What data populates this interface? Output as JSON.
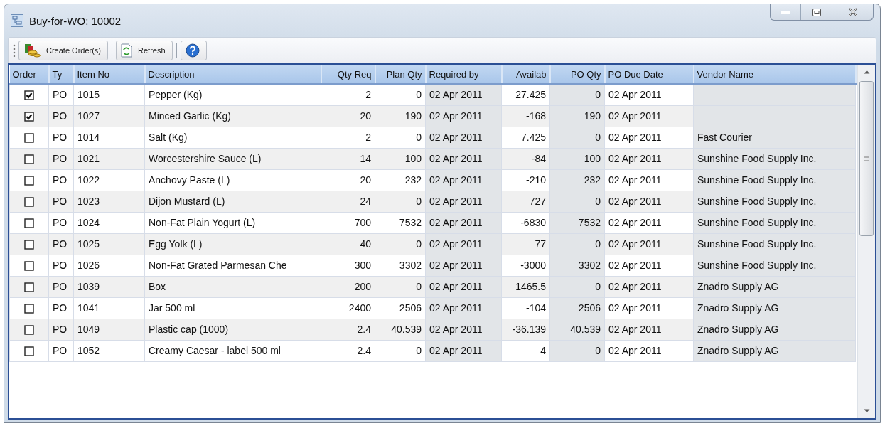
{
  "window": {
    "title": "Buy-for-WO: 10002"
  },
  "toolbar": {
    "buttons": [
      {
        "kind": "create",
        "label": "Create Order(s)"
      },
      {
        "kind": "refresh",
        "label": "Refresh"
      },
      {
        "kind": "help"
      }
    ]
  },
  "table": {
    "columns": [
      "Order",
      "Ty",
      "Item No",
      "Description",
      "Qty Req",
      "Plan Qty",
      "Required by",
      "Availab",
      "PO Qty",
      "PO Due Date",
      "Vendor Name"
    ],
    "rows": [
      {
        "checked": true,
        "cells": [
          "",
          "PO",
          "1015",
          "Pepper (Kg)",
          "2",
          "0",
          "02 Apr 2011",
          "27.425",
          "0",
          "02 Apr 2011",
          ""
        ]
      },
      {
        "checked": true,
        "cells": [
          "",
          "PO",
          "1027",
          "Minced Garlic (Kg)",
          "20",
          "190",
          "02 Apr 2011",
          "-168",
          "190",
          "02 Apr 2011",
          ""
        ]
      },
      {
        "checked": false,
        "cells": [
          "",
          "PO",
          "1014",
          "Salt (Kg)",
          "2",
          "0",
          "02 Apr 2011",
          "7.425",
          "0",
          "02 Apr 2011",
          "Fast Courier"
        ]
      },
      {
        "checked": false,
        "cells": [
          "",
          "PO",
          "1021",
          "Worcestershire Sauce (L)",
          "14",
          "100",
          "02 Apr 2011",
          "-84",
          "100",
          "02 Apr 2011",
          "Sunshine Food Supply Inc."
        ]
      },
      {
        "checked": false,
        "cells": [
          "",
          "PO",
          "1022",
          "Anchovy Paste (L)",
          "20",
          "232",
          "02 Apr 2011",
          "-210",
          "232",
          "02 Apr 2011",
          "Sunshine Food Supply Inc."
        ]
      },
      {
        "checked": false,
        "cells": [
          "",
          "PO",
          "1023",
          "Dijon Mustard (L)",
          "24",
          "0",
          "02 Apr 2011",
          "727",
          "0",
          "02 Apr 2011",
          "Sunshine Food Supply Inc."
        ]
      },
      {
        "checked": false,
        "cells": [
          "",
          "PO",
          "1024",
          "Non-Fat Plain Yogurt (L)",
          "700",
          "7532",
          "02 Apr 2011",
          "-6830",
          "7532",
          "02 Apr 2011",
          "Sunshine Food Supply Inc."
        ]
      },
      {
        "checked": false,
        "cells": [
          "",
          "PO",
          "1025",
          "Egg Yolk (L)",
          "40",
          "0",
          "02 Apr 2011",
          "77",
          "0",
          "02 Apr 2011",
          "Sunshine Food Supply Inc."
        ]
      },
      {
        "checked": false,
        "cells": [
          "",
          "PO",
          "1026",
          "Non-Fat Grated Parmesan Che",
          "300",
          "3302",
          "02 Apr 2011",
          "-3000",
          "3302",
          "02 Apr 2011",
          "Sunshine Food Supply Inc."
        ]
      },
      {
        "checked": false,
        "cells": [
          "",
          "PO",
          "1039",
          "Box",
          "200",
          "0",
          "02 Apr 2011",
          "1465.5",
          "0",
          "02 Apr 2011",
          "Znadro Supply AG"
        ]
      },
      {
        "checked": false,
        "cells": [
          "",
          "PO",
          "1041",
          "Jar 500 ml",
          "2400",
          "2506",
          "02 Apr 2011",
          "-104",
          "2506",
          "02 Apr 2011",
          "Znadro Supply AG"
        ]
      },
      {
        "checked": false,
        "cells": [
          "",
          "PO",
          "1049",
          "Plastic cap (1000)",
          "2.4",
          "40.539",
          "02 Apr 2011",
          "-36.139",
          "40.539",
          "02 Apr 2011",
          "Znadro Supply AG"
        ]
      },
      {
        "checked": false,
        "cells": [
          "",
          "PO",
          "1052",
          "Creamy Caesar - label 500 ml",
          "2.4",
          "0",
          "02 Apr 2011",
          "4",
          "0",
          "02 Apr 2011",
          "Znadro Supply AG"
        ]
      }
    ]
  }
}
